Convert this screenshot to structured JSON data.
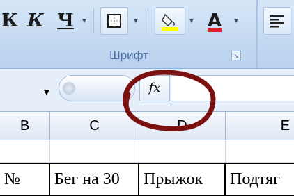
{
  "ribbon": {
    "group_label": "Шрифт",
    "buttons": [
      {
        "name": "bold-button",
        "glyph": "К"
      },
      {
        "name": "italic-button",
        "glyph": "К"
      },
      {
        "name": "underline-button",
        "glyph": "Ч"
      }
    ],
    "font_color_glyph": "A",
    "font_color": "#e02020",
    "fill_color": "#ffff00"
  },
  "formula_bar": {
    "fx_label": "fx",
    "formula": ""
  },
  "columns": [
    "B",
    "C",
    "D",
    "E"
  ],
  "table_row": [
    "№",
    "Бег на 30",
    "Прыжок",
    "Подтяг"
  ],
  "annotation_color": "#7a1010"
}
